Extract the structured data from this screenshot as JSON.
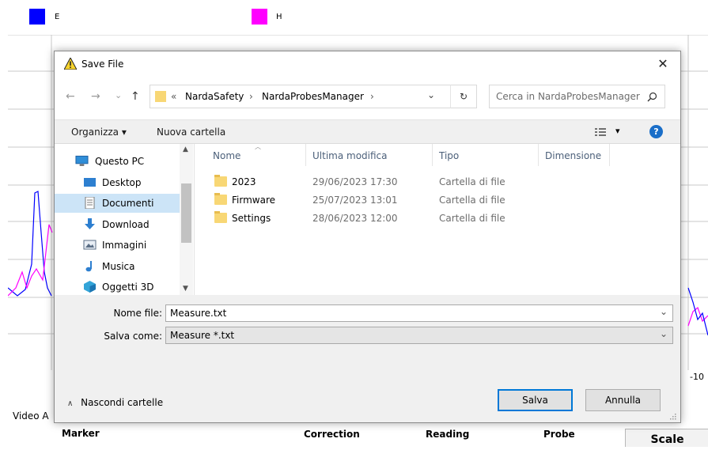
{
  "background": {
    "legend": [
      {
        "label": "E",
        "color": "#0000ff"
      },
      {
        "label": "H",
        "color": "#ff00ff"
      }
    ],
    "axis_tick": "-10",
    "video_label": "Video A",
    "bottom_labels": [
      "Marker",
      "Correction",
      "Reading",
      "Probe"
    ],
    "scale_button": "Scale"
  },
  "dialog": {
    "title": "Save File",
    "close_glyph": "✕",
    "nav": {
      "back": "←",
      "forward": "→",
      "recent": "⌄",
      "up": "↑"
    },
    "breadcrumb": [
      "«",
      "NardaSafety",
      "›",
      "NardaProbesManager",
      "›"
    ],
    "address_dropdown": "⌄",
    "refresh_glyph": "↻",
    "search_placeholder": "Cerca in NardaProbesManager",
    "toolbar": {
      "organize": "Organizza ▾",
      "new_folder": "Nuova cartella",
      "view_glyph": "▾",
      "help": "?"
    },
    "nav_pane": [
      {
        "label": "Questo PC",
        "icon": "pc-icon"
      },
      {
        "label": "Desktop",
        "icon": "desktop-icon"
      },
      {
        "label": "Documenti",
        "icon": "documents-icon",
        "selected": true
      },
      {
        "label": "Download",
        "icon": "download-icon"
      },
      {
        "label": "Immagini",
        "icon": "pictures-icon"
      },
      {
        "label": "Musica",
        "icon": "music-icon"
      },
      {
        "label": "Oggetti 3D",
        "icon": "3d-objects-icon"
      }
    ],
    "columns": [
      "Nome",
      "Ultima modifica",
      "Tipo",
      "Dimensione"
    ],
    "files": [
      {
        "name": "2023",
        "modified": "29/06/2023 17:30",
        "type": "Cartella di file"
      },
      {
        "name": "Firmware",
        "modified": "25/07/2023 13:01",
        "type": "Cartella di file"
      },
      {
        "name": "Settings",
        "modified": "28/06/2023 12:00",
        "type": "Cartella di file"
      }
    ],
    "file_name_label": "Nome file:",
    "file_name_value": "Measure.txt",
    "save_as_label": "Salva come:",
    "save_as_value": "Measure *.txt",
    "hide_folders": "Nascondi cartelle",
    "save_button": "Salva",
    "cancel_button": "Annulla"
  }
}
